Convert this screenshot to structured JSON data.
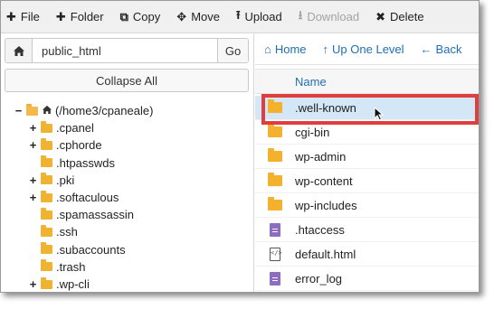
{
  "toolbar": {
    "file": "File",
    "folder": "Folder",
    "copy": "Copy",
    "move": "Move",
    "upload": "Upload",
    "download": "Download",
    "delete": "Delete"
  },
  "left": {
    "path_value": "public_html",
    "go_label": "Go",
    "collapse_label": "Collapse All",
    "tree": [
      {
        "label": "(/home3/cpaneale)",
        "toggle": "−",
        "level": 0,
        "type": "home"
      },
      {
        "label": ".cpanel",
        "toggle": "+",
        "level": 1
      },
      {
        "label": ".cphorde",
        "toggle": "+",
        "level": 1
      },
      {
        "label": ".htpasswds",
        "toggle": "",
        "level": 1
      },
      {
        "label": ".pki",
        "toggle": "+",
        "level": 1
      },
      {
        "label": ".softaculous",
        "toggle": "+",
        "level": 1
      },
      {
        "label": ".spamassassin",
        "toggle": "",
        "level": 1
      },
      {
        "label": ".ssh",
        "toggle": "",
        "level": 1
      },
      {
        "label": ".subaccounts",
        "toggle": "",
        "level": 1
      },
      {
        "label": ".trash",
        "toggle": "",
        "level": 1
      },
      {
        "label": ".wp-cli",
        "toggle": "+",
        "level": 1
      }
    ]
  },
  "right": {
    "nav": {
      "home": "Home",
      "up": "Up One Level",
      "back": "Back"
    },
    "column_name": "Name",
    "files": [
      {
        "name": ".well-known",
        "kind": "folder",
        "selected": true
      },
      {
        "name": "cgi-bin",
        "kind": "folder"
      },
      {
        "name": "wp-admin",
        "kind": "folder"
      },
      {
        "name": "wp-content",
        "kind": "folder"
      },
      {
        "name": "wp-includes",
        "kind": "folder"
      },
      {
        "name": ".htaccess",
        "kind": "file"
      },
      {
        "name": "default.html",
        "kind": "html"
      },
      {
        "name": "error_log",
        "kind": "file"
      }
    ]
  },
  "colors": {
    "accent_link": "#1f6fb4",
    "folder": "#f3b12e",
    "highlight_border": "#e03e3e",
    "selected_row": "#d4e7f7"
  }
}
